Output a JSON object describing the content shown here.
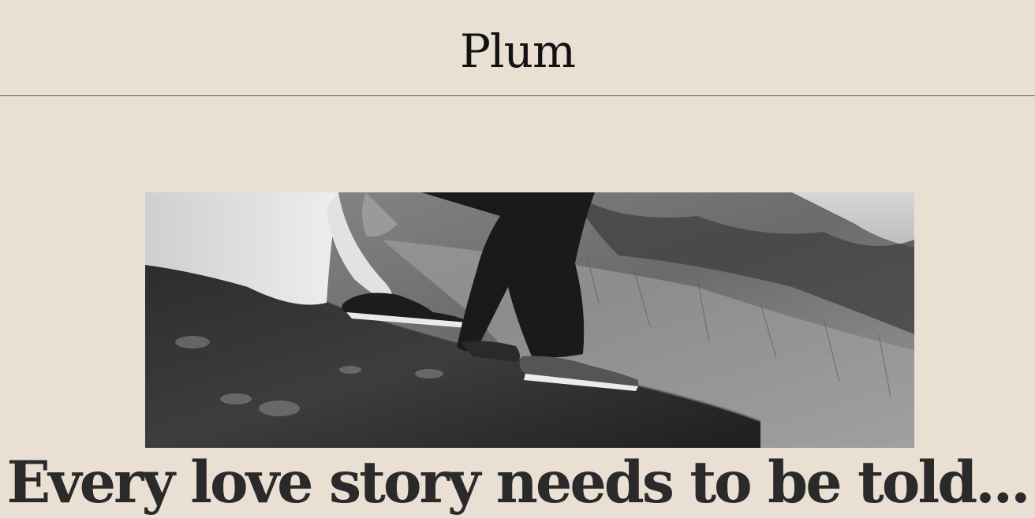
{
  "header": {
    "brand": "Plum"
  },
  "hero": {
    "tagline": "Every love story needs to be told..."
  }
}
